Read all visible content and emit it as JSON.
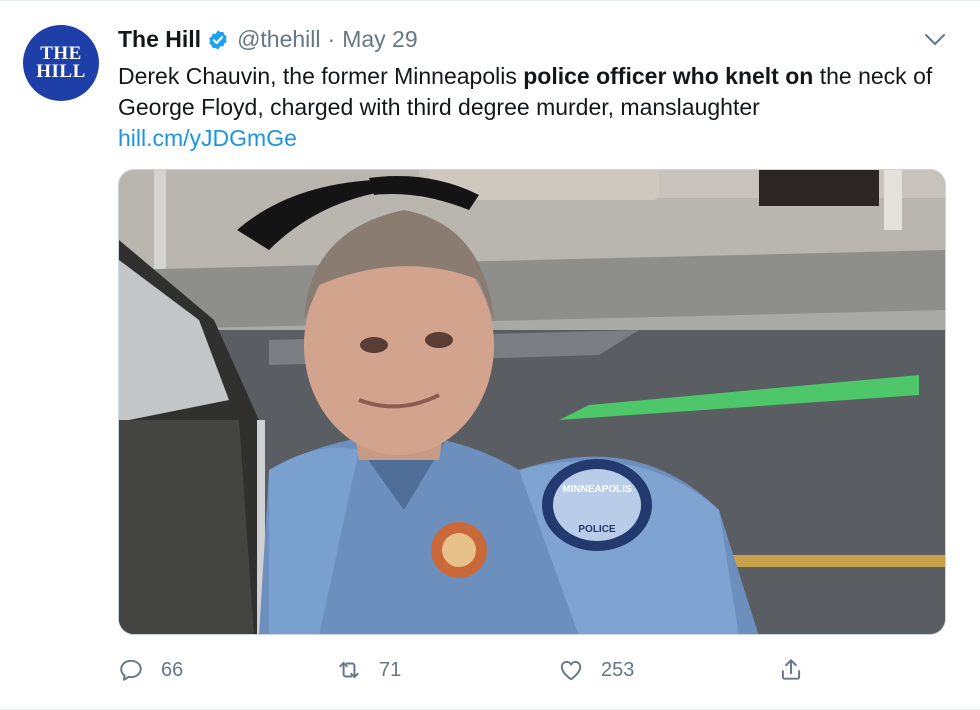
{
  "tweet": {
    "avatar_line1": "THE",
    "avatar_line2": "HILL",
    "name": "The Hill",
    "handle": "@thehill",
    "separator": "·",
    "date": "May 29",
    "text_part1": "Derek Chauvin, the former Minneapolis ",
    "text_bold": "police officer who knelt on",
    "text_part2": " the neck of George Floyd, charged with third degree murder, manslaughter",
    "link": "hill.cm/yJDGmGe",
    "badge_line1": "MINNEAPOLIS",
    "badge_line2": "POLICE"
  },
  "actions": {
    "replies": "66",
    "retweets": "71",
    "likes": "253"
  },
  "icons": {
    "verified": "verified-badge-icon",
    "menu": "chevron-down-icon",
    "reply": "reply-icon",
    "retweet": "retweet-icon",
    "like": "heart-icon",
    "share": "share-icon"
  },
  "colors": {
    "link": "#1b95e0",
    "verified": "#1da1f2",
    "avatar_bg": "#1f3fa8",
    "muted": "#657786"
  }
}
